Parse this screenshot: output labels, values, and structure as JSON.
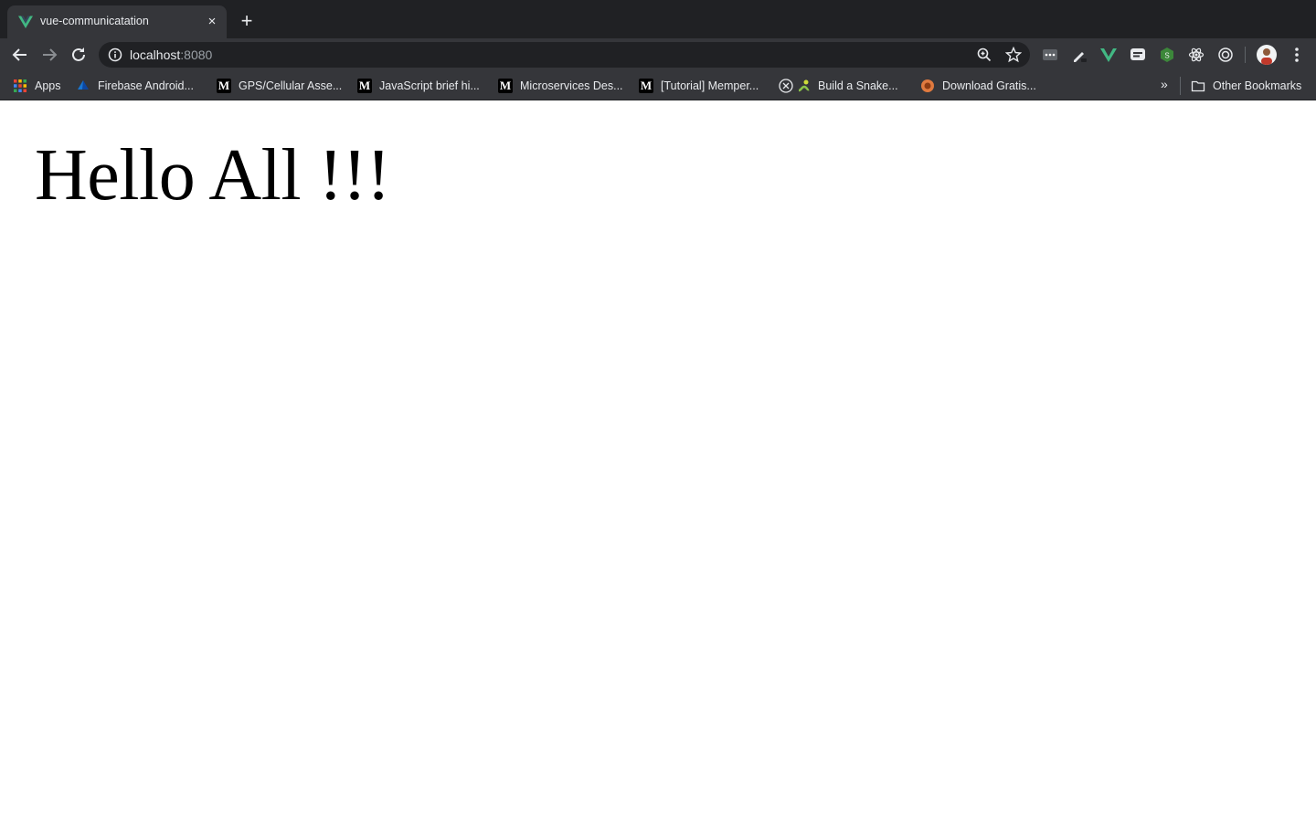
{
  "browser": {
    "tab": {
      "title": "vue-communicatation",
      "close_label": "×"
    },
    "new_tab_label": "+",
    "address_bar": {
      "host": "localhost",
      "port": ":8080"
    },
    "bookmarks": [
      {
        "label": "Apps",
        "icon": "apps-grid-icon"
      },
      {
        "label": "Firebase Android...",
        "icon": "firebase-icon"
      },
      {
        "label": "GPS/Cellular Asse...",
        "icon": "medium-icon"
      },
      {
        "label": "JavaScript brief hi...",
        "icon": "medium-icon"
      },
      {
        "label": "Microservices Des...",
        "icon": "medium-icon"
      },
      {
        "label": "[Tutorial] Memper...",
        "icon": "medium-icon"
      },
      {
        "label": "Build a Snake...",
        "icon": "snake-icon"
      },
      {
        "label": "Download Gratis...",
        "icon": "download-site-icon"
      }
    ],
    "overflow_label": "»",
    "other_bookmarks_label": "Other Bookmarks",
    "colors": {
      "tabstrip": "#202124",
      "toolbar": "#35363a",
      "vue_green": "#42b883"
    }
  },
  "page": {
    "heading": "Hello All !!!"
  }
}
